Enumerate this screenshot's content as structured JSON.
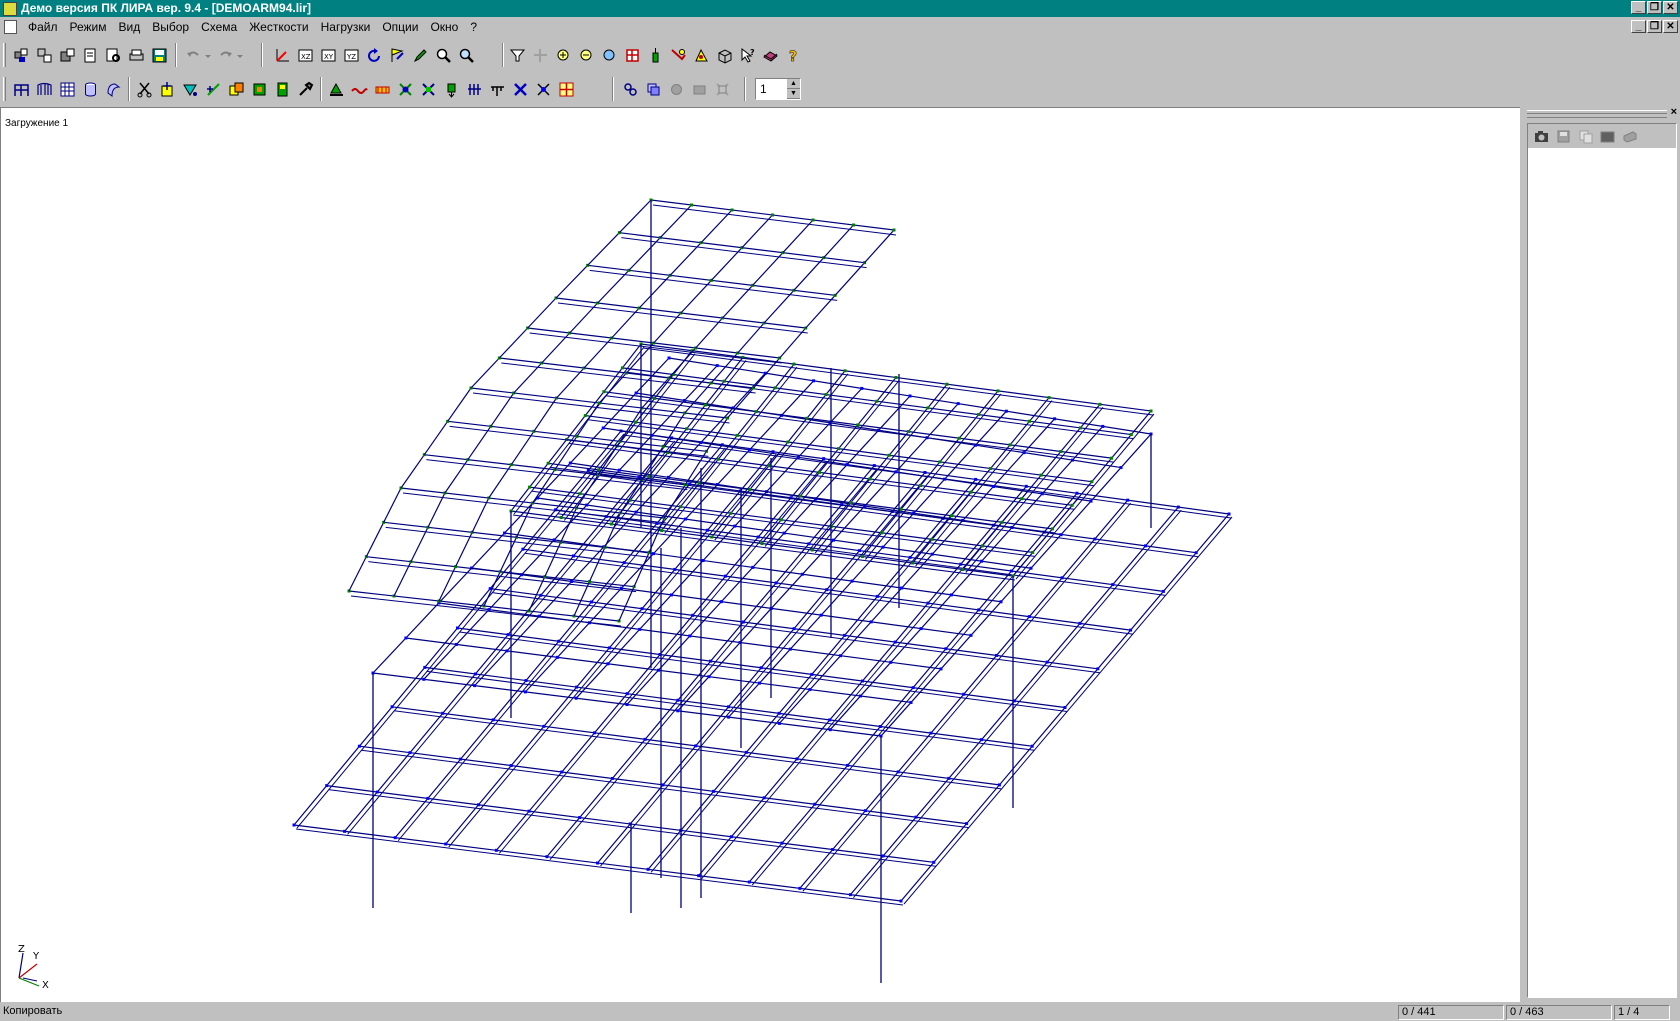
{
  "window": {
    "title": "Демо версия ПК ЛИРА  вер. 9.4 - [DEMOARM94.lir]"
  },
  "window_buttons": [
    "_",
    "❐",
    "✕"
  ],
  "menu": [
    "Файл",
    "Режим",
    "Вид",
    "Выбор",
    "Схема",
    "Жесткости",
    "Нагрузки",
    "Опции",
    "Окно",
    "?"
  ],
  "toolbar": {
    "loadcase_value": "1"
  },
  "view": {
    "load_label": "Загружение  1"
  },
  "axes": {
    "z": "Z",
    "y": "Y",
    "x": "X"
  },
  "status": {
    "message": "Копировать",
    "nodes": "0 / 441",
    "elements": "0 / 463",
    "page": "1 / 4"
  },
  "colors": {
    "title_bg": "#008080",
    "mesh_line": "#000080",
    "node_blue": "#0000ff",
    "node_green": "#008000"
  }
}
